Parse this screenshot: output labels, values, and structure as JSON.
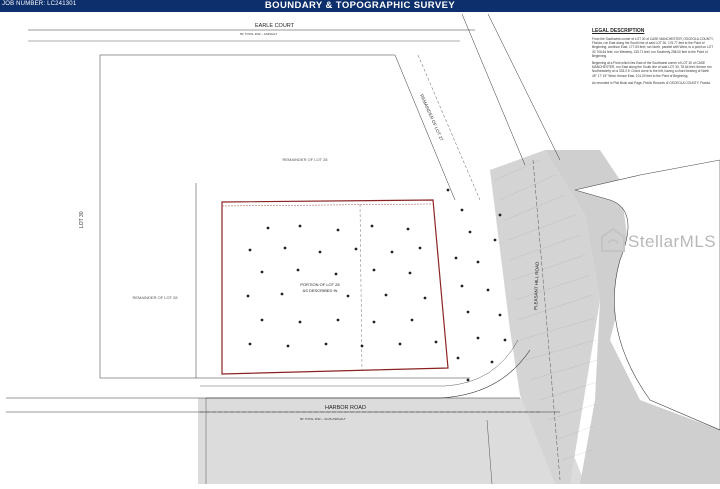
{
  "header": {
    "job_number": "JOB NUMBER: LC241301",
    "title": "BOUNDARY & TOPOGRAPHIC SURVEY"
  },
  "labels": {
    "earle_court": "EARLE COURT",
    "earle_court_row": "50' TOTAL R/W ~ ASPHALT",
    "harbor_road": "HARBOR ROAD",
    "harbor_road_row": "80' TOTAL R/W ~ 40.25 ASPHALT",
    "pleasant_hill_road": "PLEASANT HILL ROAD",
    "lot_30": "LOT 30",
    "remainder_lot_28_top": "REMAINDER OF LOT 28",
    "remainder_lot_28_left": "REMAINDER OF LOT 28",
    "remainder_lot_27": "REMAINDER OF LOT 27",
    "portion_lot": [
      "PORTION OF LOT 28",
      "AS DESCRIBED IN"
    ]
  },
  "legal": {
    "title": "LEGAL DESCRIPTION",
    "paragraphs": [
      "From the Southwest corner of LOT 30 of CASE MANCHESTER, OSCEOLA COUNTY, Florida, run East along the South line of said LOT 30, 176.77 feet to the Point of Beginning; continue East, 177.53 feet; run North, parallel with West, to a point on LOT 30 706.64 feet, run Westerly, 135.71 feet; run Southerly 258.00 feet to the Point of Beginning.",
      "Beginning at a Point which lies East of the Southwest corner of LOT 30 of CASE MANCHESTER, run East along the South line of said LOT 30, 78.64 feet; thence run Northeasterly on a 333.0 ft. Chord curve to the left, having a chord bearing of North 45° 17' 15\" West; thence East, 101.00 feet to the Point of Beginning.",
      "As recorded in Plat Book and Page, Public Records of OSCEOLA COUNTY, Florida."
    ]
  },
  "watermark": "StellarMLS",
  "colors": {
    "header": "#0d2f6b",
    "road": "#d9d9d9",
    "line": "#333333",
    "boundary": "#8b2323"
  }
}
